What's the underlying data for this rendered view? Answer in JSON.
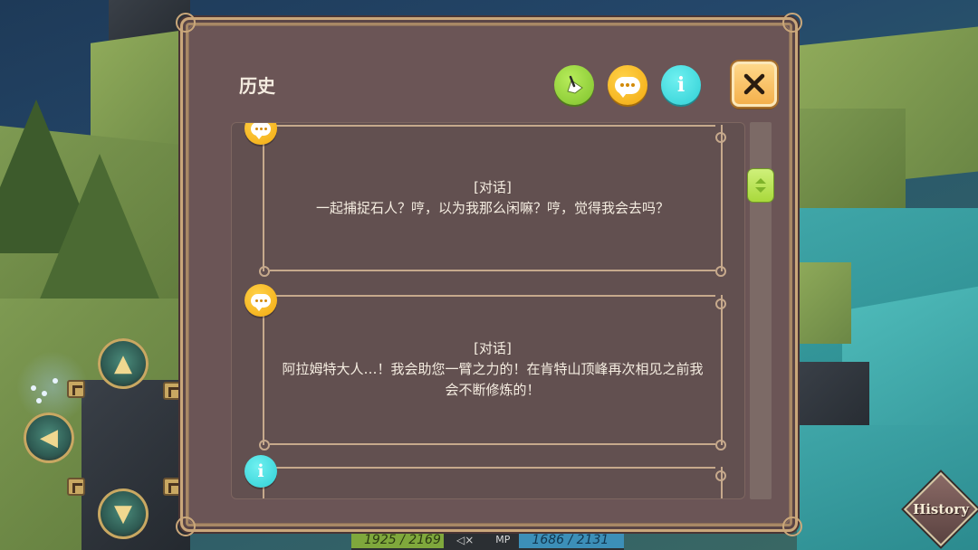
{
  "dialog": {
    "title": "历史",
    "header_icons": [
      "quill-icon",
      "chat-bubble-icon",
      "info-icon"
    ],
    "close_icon": "close-icon",
    "entries": [
      {
        "type": "chat",
        "icon": "chat-bubble-icon",
        "tag": "[对话]",
        "lines": [
          "一起捕捉石人？哼，以为我那么闲嘛？哼，觉得我会去吗？"
        ]
      },
      {
        "type": "chat",
        "icon": "chat-bubble-icon",
        "tag": "[对话]",
        "lines": [
          "阿拉姆特大人…！我会助您一臂之力的！在肯特山顶峰再次相见之前我",
          "会不断修炼的！"
        ]
      },
      {
        "type": "info",
        "icon": "info-icon",
        "tag": "",
        "lines": []
      }
    ]
  },
  "hud": {
    "history_button": "History",
    "hp": {
      "value": "1925 / 2169",
      "fraction": 0.887
    },
    "mp_label": "MP",
    "mp": {
      "value": "1686 / 2131",
      "fraction": 0.791
    },
    "mute_glyph": "◁×"
  },
  "colors": {
    "panel": "#6b5556",
    "gold_border": "#caa77a",
    "chat_yellow": "#f2a90f",
    "info_cyan": "#2fcfd5",
    "quill_green": "#7fc22c",
    "scroll_thumb": "#a9d93c"
  }
}
